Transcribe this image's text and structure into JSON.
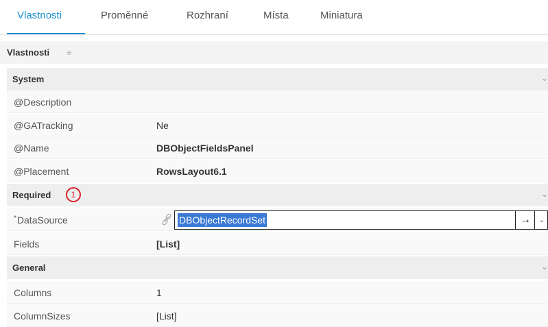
{
  "tabs": [
    "Vlastnosti",
    "Proměnné",
    "Rozhraní",
    "Místa",
    "Miniatura"
  ],
  "panel_title": "Vlastnosti",
  "icons": {
    "menu": "list-icon",
    "link": "link-icon",
    "arrow": "arrow-right-icon",
    "chevron": "chevron-down-icon"
  },
  "sections": {
    "system": "System",
    "required": "Required",
    "general": "General"
  },
  "annotation": "1",
  "props": {
    "description": {
      "label": "@Description",
      "value": ""
    },
    "gatracking": {
      "label": "@GATracking",
      "value": "Ne"
    },
    "name": {
      "label": "@Name",
      "value": "DBObjectFieldsPanel"
    },
    "placement": {
      "label": "@Placement",
      "value": "RowsLayout6.1"
    },
    "datasource": {
      "marker": "*",
      "label": "DataSource",
      "value": "DBObjectRecordSet"
    },
    "fields": {
      "label": "Fields",
      "value": "[List]"
    },
    "columns": {
      "label": "Columns",
      "value": "1"
    },
    "columnsizes": {
      "label": "ColumnSizes",
      "value": "[List]"
    }
  },
  "colors": {
    "accent": "#1a8fd1",
    "selection": "#3a79d4",
    "annotation": "#d8232a"
  }
}
